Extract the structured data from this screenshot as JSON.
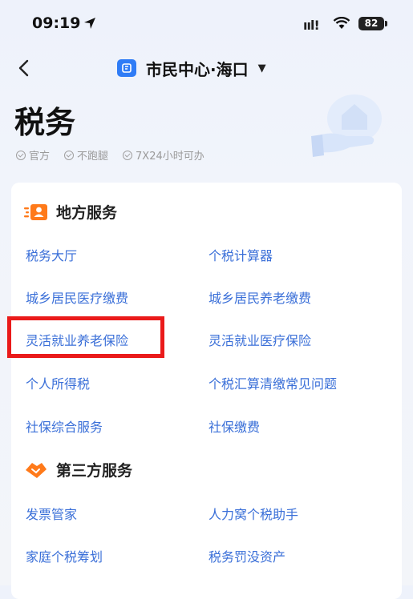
{
  "status_bar": {
    "time": "09:19",
    "signal": "ııl!",
    "battery": "82"
  },
  "nav": {
    "title": "市民中心·海口"
  },
  "page": {
    "title": "税务",
    "tags": [
      "官方",
      "不跑腿",
      "7X24小时可办"
    ]
  },
  "local_services": {
    "title": "地方服务",
    "items": [
      "税务大厅",
      "个税计算器",
      "城乡居民医疗缴费",
      "城乡居民养老缴费",
      "灵活就业养老保险",
      "灵活就业医疗保险",
      "个人所得税",
      "个税汇算清缴常见问题",
      "社保综合服务",
      "社保缴费"
    ]
  },
  "third_party_services": {
    "title": "第三方服务",
    "items": [
      "发票管家",
      "人力窝个税助手",
      "家庭个税筹划",
      "税务罚没资产"
    ]
  },
  "colors": {
    "link": "#3a6fd8",
    "accent": "#2f7cf6",
    "highlight": "#ea1a1a",
    "orange": "#ff7a1a"
  }
}
